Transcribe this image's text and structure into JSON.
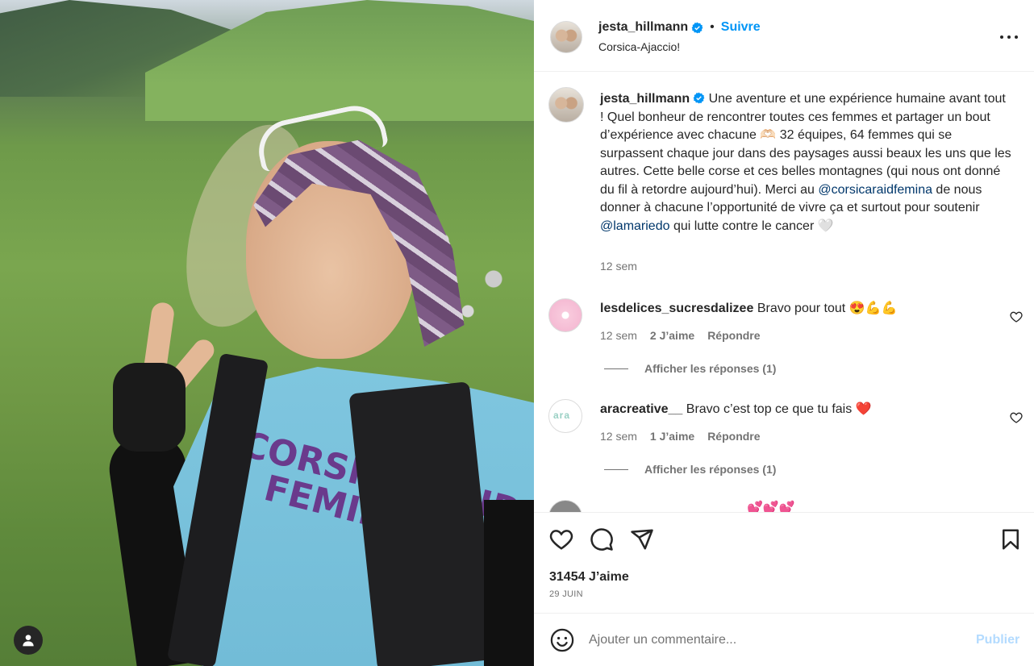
{
  "post": {
    "username": "jesta_hillmann",
    "follow_label": "Suivre",
    "separator": "•",
    "location": "Corsica-Ajaccio!"
  },
  "photo": {
    "shirt_text_1": "CORSICA RAID",
    "shirt_text_2": "FEMINA"
  },
  "caption": {
    "username": "jesta_hillmann",
    "text_1": " Une aventure et une expérience humaine avant tout ! Quel bonheur de rencontrer toutes ces femmes et partager un bout d’expérience avec chacune 🫶🏻 32 équipes, 64 femmes qui se surpassent chaque jour dans des paysages aussi beaux les uns que les autres. Cette belle corse et ces belles montagnes (qui nous ont donné du fil à retordre aujourd’hui). Merci au ",
    "mention_1": "@corsicaraidfemina",
    "text_2": " de nous donner à chacune l’opportunité de vivre ça et surtout pour soutenir ",
    "mention_2": "@lamariedo",
    "text_3": " qui lutte contre le cancer 🤍",
    "time": "12 sem"
  },
  "comments": [
    {
      "username": "lesdelices_sucresdalizee",
      "text": "Bravo pour tout 😍💪💪",
      "time": "12 sem",
      "likes": "2 J’aime",
      "reply": "Répondre",
      "view_replies": "Afficher les réponses (1)"
    },
    {
      "username": "aracreative__",
      "avatar_text": "ara",
      "text": "Bravo c’est top ce que tu fais ❤️",
      "time": "12 sem",
      "likes": "1 J’aime",
      "reply": "Répondre",
      "view_replies": "Afficher les réponses (1)"
    }
  ],
  "partial_comment": "💕💕💕",
  "actions": {
    "likes": "31454 J’aime",
    "date": "29 JUIN"
  },
  "add_comment": {
    "placeholder": "Ajouter un commentaire...",
    "publish_label": "Publier"
  },
  "colors": {
    "accent": "#0095f6",
    "mention": "#00376b",
    "muted": "#737373",
    "publish_disabled": "#b3dbff"
  }
}
